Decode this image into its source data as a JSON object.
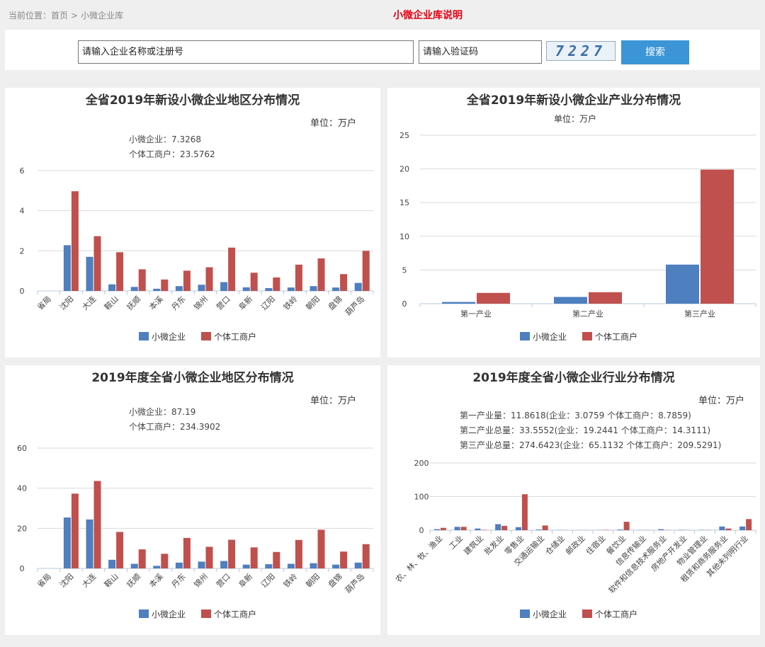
{
  "header": {
    "breadcrumb": {
      "prefix": "当前位置：",
      "home": "首页",
      "sep": ">",
      "current": "小微企业库"
    },
    "top_link": "小微企业库说明"
  },
  "search": {
    "name_placeholder": "请输入企业名称或注册号",
    "code_placeholder": "请输入验证码",
    "captcha_text": "7227",
    "button_label": "搜索"
  },
  "colors": {
    "small_enterprise": "#4e7fbf",
    "individual": "#c0504d",
    "grid": "#d9d9d9",
    "axis": "#b8c8dc"
  },
  "chart_data": [
    {
      "type": "bar",
      "title": "全省2019年新设小微企业地区分布情况",
      "unit": "单位：万户",
      "notes": [
        "小微企业：7.3268",
        "个体工商户：23.5762"
      ],
      "categories": [
        "省局",
        "沈阳",
        "大连",
        "鞍山",
        "抚顺",
        "本溪",
        "丹东",
        "锦州",
        "营口",
        "阜新",
        "辽阳",
        "铁岭",
        "朝阳",
        "盘锦",
        "葫芦岛"
      ],
      "series": [
        {
          "name": "小微企业",
          "values": [
            0,
            2.28,
            1.7,
            0.33,
            0.2,
            0.11,
            0.24,
            0.31,
            0.44,
            0.18,
            0.14,
            0.17,
            0.24,
            0.17,
            0.4
          ]
        },
        {
          "name": "个体工商户",
          "values": [
            0,
            4.97,
            2.73,
            1.93,
            1.08,
            0.57,
            1.01,
            1.18,
            2.16,
            0.91,
            0.67,
            1.31,
            1.62,
            0.84,
            2.0
          ]
        }
      ],
      "yticks": [
        0,
        2,
        4,
        6
      ],
      "ylim": [
        0,
        6
      ],
      "legend": "bottom"
    },
    {
      "type": "bar",
      "title": "全省2019年新设小微企业产业分布情况",
      "unit": "单位：万户",
      "categories": [
        "第一产业",
        "第二产业",
        "第三产业"
      ],
      "series": [
        {
          "name": "小微企业",
          "values": [
            0.25,
            1.0,
            5.8
          ]
        },
        {
          "name": "个体工商户",
          "values": [
            1.6,
            1.7,
            19.9
          ]
        }
      ],
      "yticks": [
        0,
        5,
        10,
        15,
        20,
        25
      ],
      "ylim": [
        0,
        25
      ],
      "legend": "bottom"
    },
    {
      "type": "bar",
      "title": "2019年度全省小微企业地区分布情况",
      "unit": "单位：万户",
      "notes": [
        "小微企业：87.19",
        "个体工商户：234.3902"
      ],
      "categories": [
        "省局",
        "沈阳",
        "大连",
        "鞍山",
        "抚顺",
        "本溪",
        "丹东",
        "锦州",
        "营口",
        "阜新",
        "辽阳",
        "铁岭",
        "朝阳",
        "盘锦",
        "葫芦岛"
      ],
      "series": [
        {
          "name": "小微企业",
          "values": [
            0,
            25.4,
            24.4,
            4.3,
            2.3,
            1.3,
            2.9,
            3.4,
            3.7,
            1.9,
            2.1,
            2.3,
            2.6,
            1.9,
            2.9
          ]
        },
        {
          "name": "个体工商户",
          "values": [
            0,
            37.3,
            43.6,
            18.2,
            9.5,
            7.3,
            15.2,
            10.8,
            14.3,
            10.5,
            8.2,
            14.2,
            19.3,
            8.4,
            12.1
          ]
        }
      ],
      "yticks": [
        0,
        20,
        40,
        60
      ],
      "ylim": [
        0,
        60
      ],
      "legend": "bottom"
    },
    {
      "type": "bar",
      "title": "2019年度全省小微企业行业分布情况",
      "unit": "单位：万户",
      "notes": [
        "第一产业量：11.8618(企业：3.0759  个体工商户：8.7859)",
        "第二产业总量：33.5552(企业：19.2441  个体工商户：14.3111)",
        "第三产业总量：274.6423(企业：65.1132  个体工商户：209.5291)"
      ],
      "categories": [
        "农、林、牧、渔业",
        "工业",
        "建筑业",
        "批发业",
        "零售业",
        "交通运输业",
        "仓储业",
        "邮政业",
        "住宿业",
        "餐饮业",
        "信息传输业",
        "软件和信息技术服务业",
        "房地产开发业",
        "物业管理业",
        "租赁和商务服务业",
        "其他未列明行业"
      ],
      "series": [
        {
          "name": "小微企业",
          "values": [
            3,
            10,
            5,
            18,
            9,
            2,
            0.5,
            0.3,
            0.5,
            2,
            0.5,
            3,
            1,
            0.8,
            11,
            11
          ]
        },
        {
          "name": "个体工商户",
          "values": [
            7,
            10,
            1,
            13,
            107,
            14,
            0.3,
            0.3,
            1,
            25,
            0.5,
            0.5,
            0.5,
            0.5,
            5,
            33
          ]
        }
      ],
      "yticks": [
        0,
        100,
        200
      ],
      "ylim": [
        0,
        200
      ],
      "legend": "bottom"
    }
  ]
}
